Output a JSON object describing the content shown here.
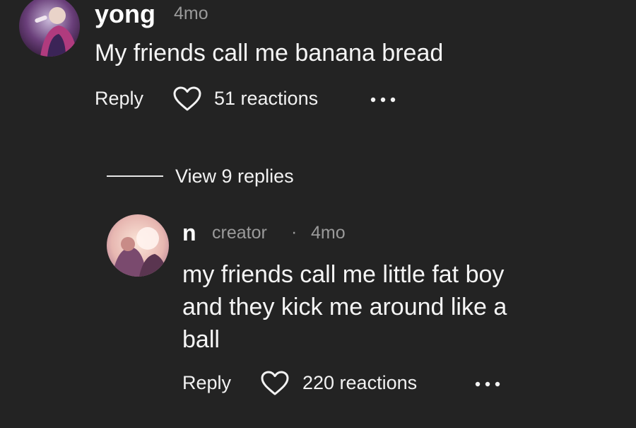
{
  "comments": [
    {
      "username": "yong",
      "time": "4mo",
      "text": "My friends call me banana bread",
      "reply_label": "Reply",
      "reactions": "51 reactions",
      "avatar_icon": "profile-photo",
      "like_icon": "heart-outline-icon",
      "more_icon": "more-options-icon"
    }
  ],
  "thread": {
    "view_replies": "View 9 replies"
  },
  "replies": [
    {
      "username": "n",
      "badge": "creator",
      "separator": "·",
      "time": "4mo",
      "text_lines": [
        "my friends call me little fat boy",
        "and they kick me around like a",
        "ball"
      ],
      "reply_label": "Reply",
      "reactions": "220 reactions",
      "avatar_icon": "profile-photo",
      "like_icon": "heart-outline-icon",
      "more_icon": "more-options-icon"
    }
  ],
  "colors": {
    "background": "#232323",
    "primary_text": "#f5f5f5",
    "secondary_text": "#9a9a9a"
  }
}
